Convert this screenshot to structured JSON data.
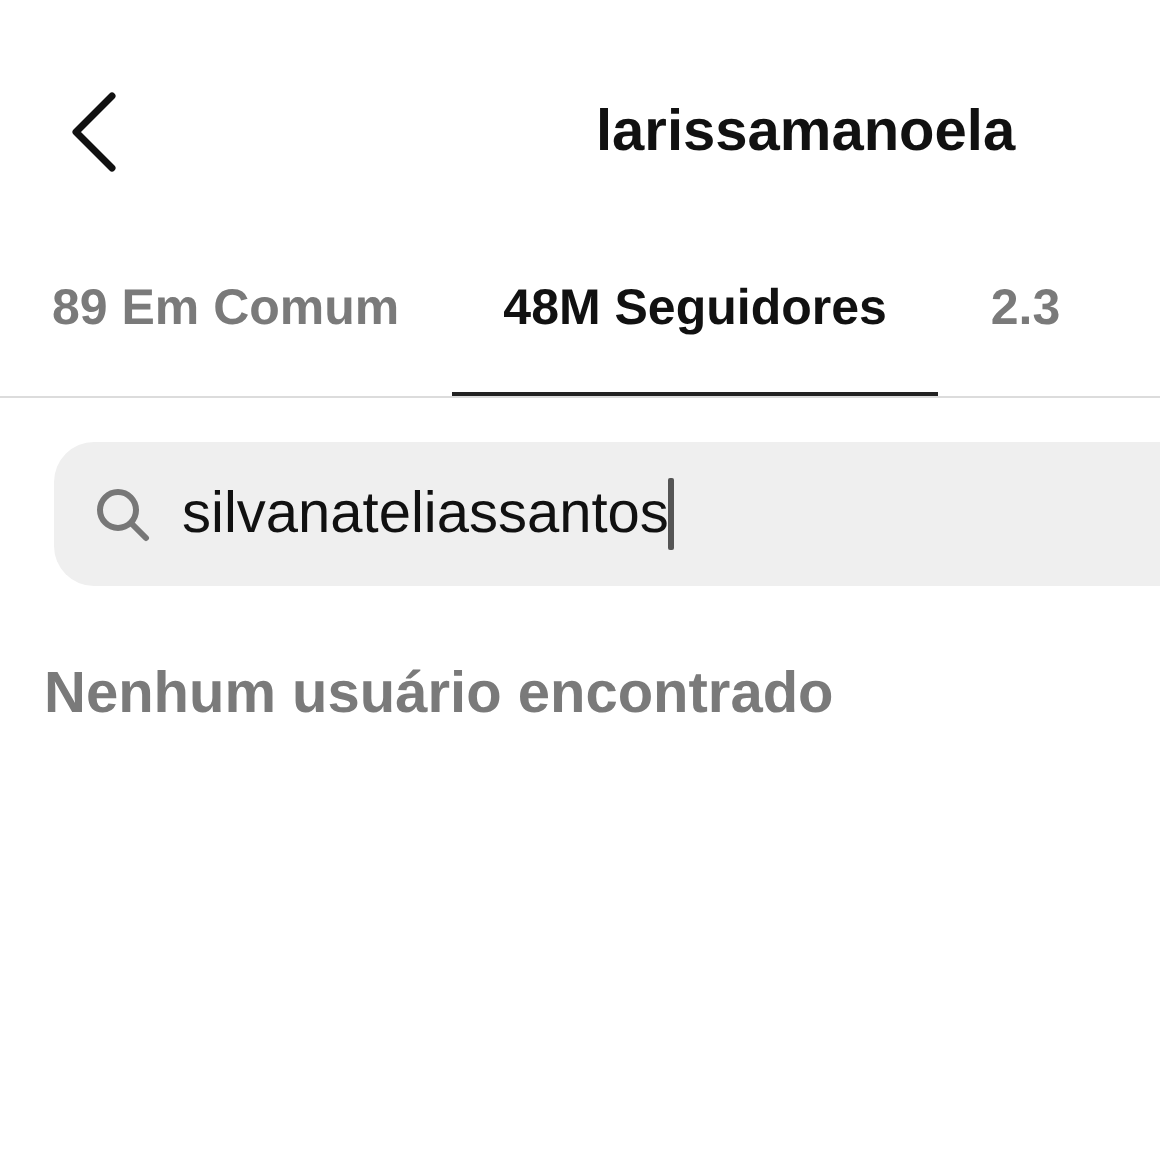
{
  "header": {
    "title": "larissamanoela"
  },
  "tabs": [
    {
      "label": "89 Em Comum",
      "selected": false
    },
    {
      "label": "48M Seguidores",
      "selected": true
    },
    {
      "label": "2.3",
      "selected": false
    }
  ],
  "search": {
    "value": "silvanateliassantos"
  },
  "message": "Nenhum usuário encontrado"
}
